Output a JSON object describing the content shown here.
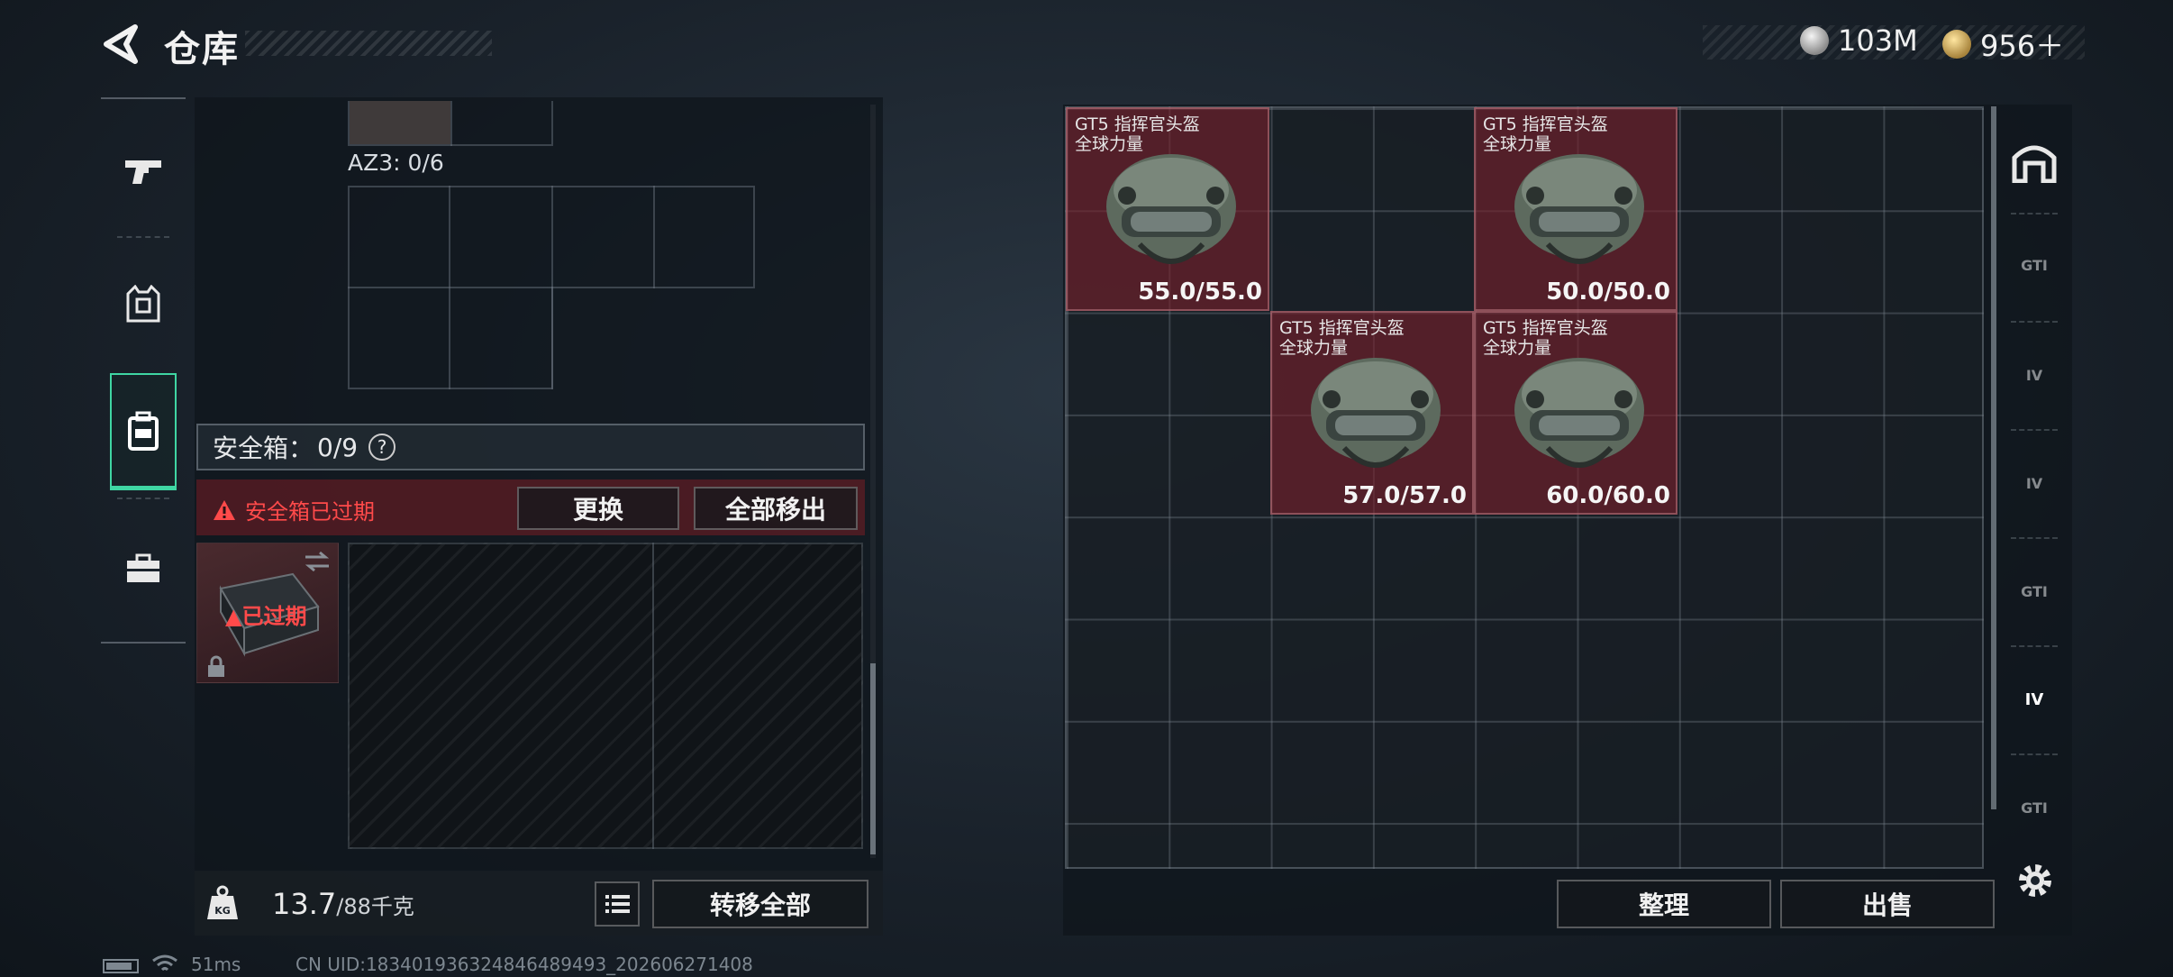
{
  "header": {
    "title": "仓库",
    "currency1": "103M",
    "currency2": "956＋"
  },
  "nav": {
    "items": [
      {
        "icon": "pistol-icon"
      },
      {
        "icon": "vest-icon"
      },
      {
        "icon": "backpack-icon",
        "active": true
      },
      {
        "icon": "toolbox-icon"
      }
    ]
  },
  "left": {
    "az3_label": "AZ3: 0/6",
    "safe_label": "安全箱：",
    "safe_count": "0/9",
    "help": "?",
    "expired_text": "安全箱已过期",
    "replace_btn": "更换",
    "move_all_btn": "全部移出",
    "thumb_expired": "已过期",
    "weight_value": "13.7",
    "weight_max": "/88千克",
    "transfer_all_btn": "转移全部"
  },
  "items": [
    {
      "name": "GT5 指挥官头盔\n全球力量",
      "durability": "55.0/55.0"
    },
    {
      "name": "GT5 指挥官头盔\n全球力量",
      "durability": "50.0/50.0"
    },
    {
      "name": "GT5 指挥官头盔\n全球力量",
      "durability": "57.0/57.0"
    },
    {
      "name": "GT5 指挥官头盔\n全球力量",
      "durability": "60.0/60.0"
    }
  ],
  "right": {
    "sort_btn": "整理",
    "sell_btn": "出售",
    "side_labels": [
      "GTI",
      "IV",
      "IV",
      "GTI",
      "IV",
      "GTI"
    ]
  },
  "footer": {
    "ping": "51ms",
    "uid": "CN UID:1834019363248464894​93_202606271408"
  },
  "colors": {
    "accent": "#3fd6a3",
    "expired_red": "#ff4a4a",
    "item_bg": "#7a2030"
  }
}
